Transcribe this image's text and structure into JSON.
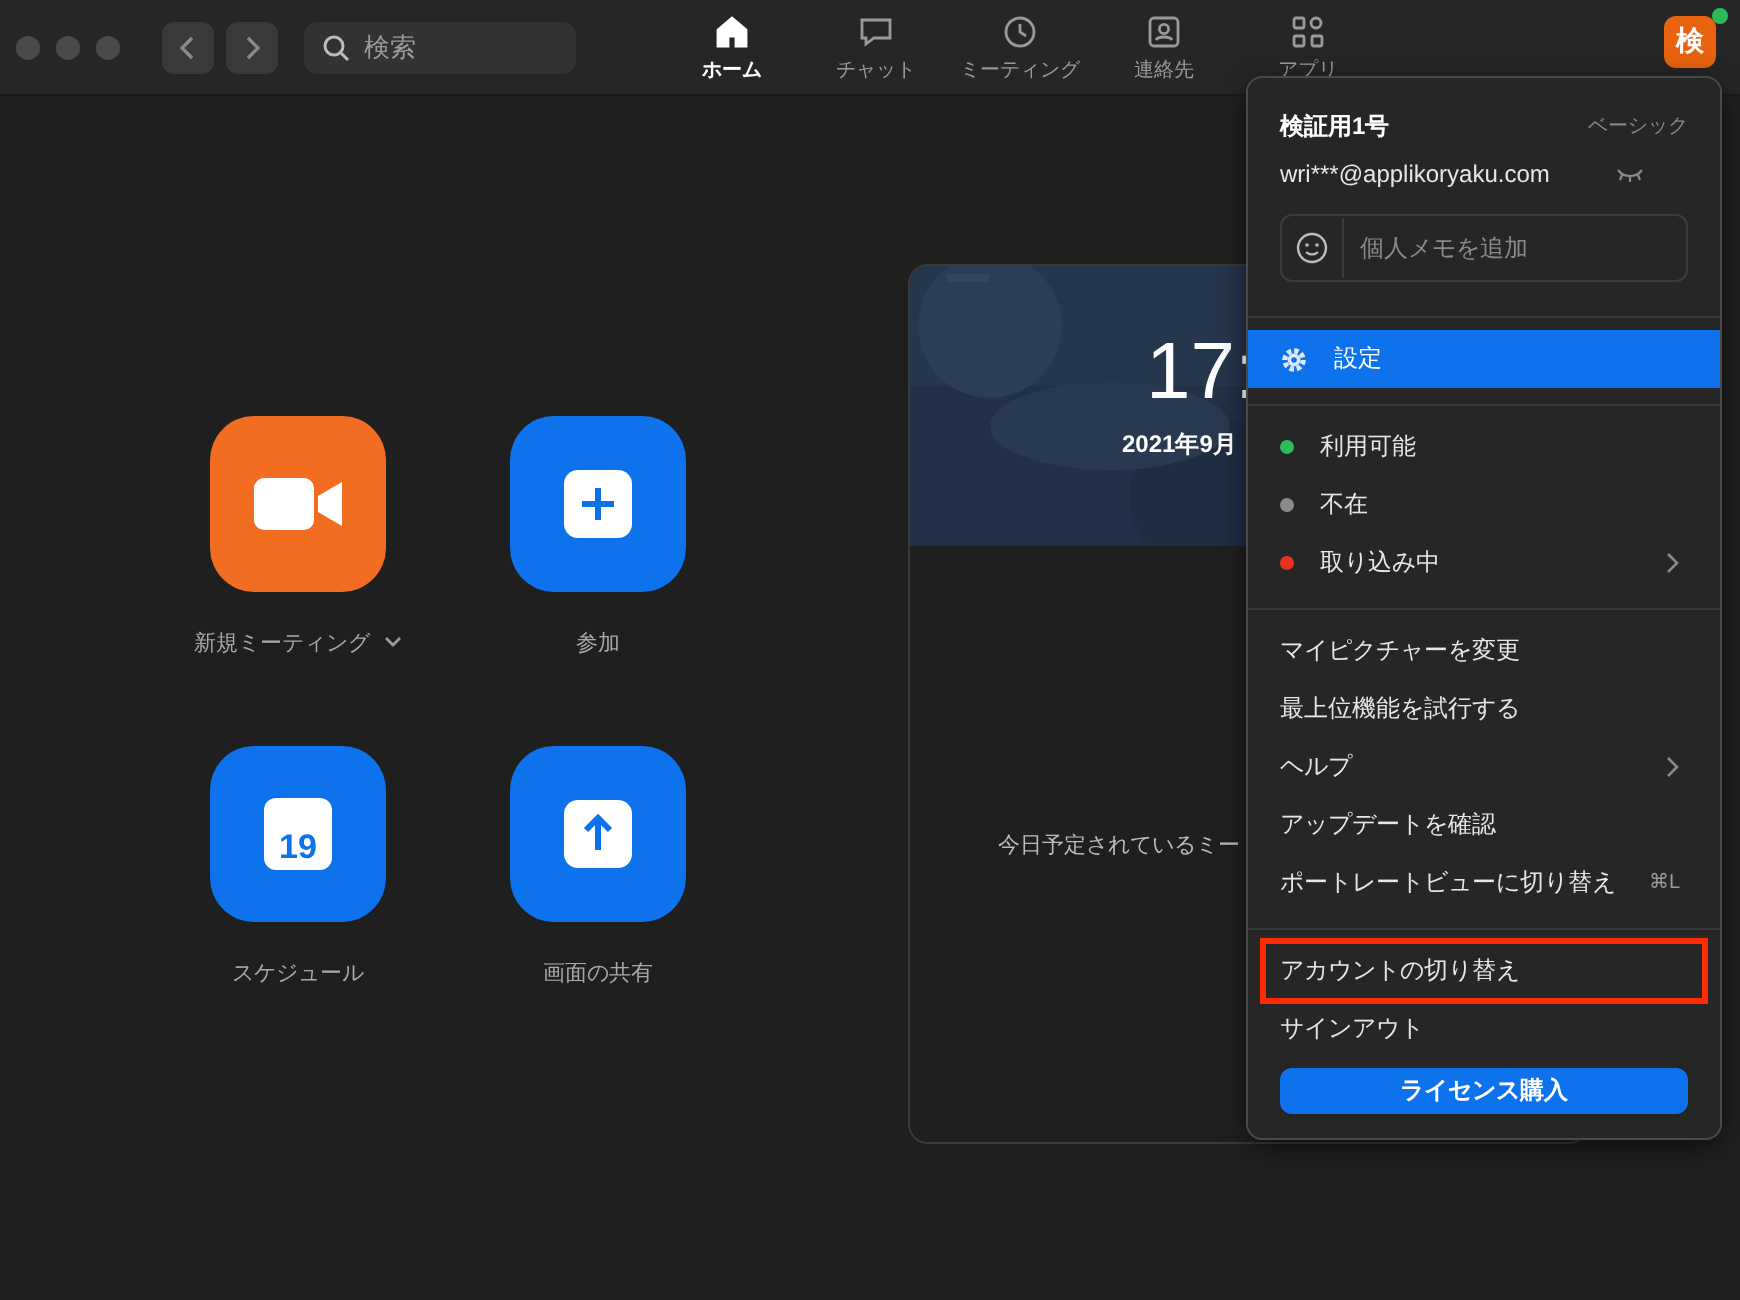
{
  "search": {
    "placeholder": "検索"
  },
  "tabs": [
    {
      "label": "ホーム",
      "selected": true
    },
    {
      "label": "チャット",
      "selected": false
    },
    {
      "label": "ミーティング",
      "selected": false
    },
    {
      "label": "連絡先",
      "selected": false
    },
    {
      "label": "アプリ",
      "selected": false
    }
  ],
  "avatar": {
    "initial": "検",
    "online": true
  },
  "actions": [
    {
      "label": "新規ミーティング",
      "color": "#f26d21",
      "kind": "dropdown"
    },
    {
      "label": "参加",
      "color": "#0e72ed",
      "kind": "button"
    },
    {
      "label": "スケジュール",
      "color": "#0e72ed",
      "kind": "button",
      "calendar_day": "19"
    },
    {
      "label": "画面の共有",
      "color": "#0e72ed",
      "kind": "button"
    }
  ],
  "card": {
    "time": "17:",
    "date": "2021年9月",
    "message": "今日予定されているミー"
  },
  "menu": {
    "name": "検証用1号",
    "plan": "ベーシック",
    "email": "wri***@applikoryaku.com",
    "memo": {
      "placeholder": "個人メモを追加"
    },
    "settings": {
      "label": "設定",
      "selected": true
    },
    "statuses": [
      {
        "label": "利用可能",
        "color": "#2dbb5a",
        "has_submenu": false
      },
      {
        "label": "不在",
        "color": "#8a8a8a",
        "has_submenu": false
      },
      {
        "label": "取り込み中",
        "color": "#e8321e",
        "has_submenu": true
      }
    ],
    "items": [
      {
        "label": "マイピクチャーを変更",
        "has_submenu": false
      },
      {
        "label": "最上位機能を試行する",
        "has_submenu": false
      },
      {
        "label": "ヘルプ",
        "has_submenu": true
      },
      {
        "label": "アップデートを確認",
        "has_submenu": false
      },
      {
        "label": "ポートレートビューに切り替え",
        "has_submenu": false,
        "shortcut": "⌘L"
      }
    ],
    "account_items": [
      {
        "label": "アカウントの切り替え",
        "highlighted": true
      },
      {
        "label": "サインアウト",
        "highlighted": false
      }
    ],
    "button": "ライセンス購入"
  }
}
